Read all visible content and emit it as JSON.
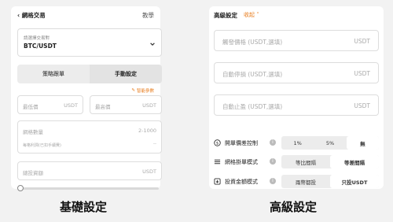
{
  "basic": {
    "header": {
      "back_label": "網格交易",
      "tutorial": "教學"
    },
    "pair": {
      "label": "請選擇交易對",
      "value": "BTC/USDT"
    },
    "tabs": [
      "策略跟單",
      "手動設定"
    ],
    "smart_param": "智能參數",
    "low_price": {
      "placeholder": "最低價",
      "unit": "USDT"
    },
    "high_price": {
      "placeholder": "最高價",
      "unit": "USDT"
    },
    "grid_count": {
      "placeholder": "網格數量",
      "range": "2-1000",
      "sub": "每格利潤(已扣手續費)",
      "sub_value": "--"
    },
    "investment": {
      "placeholder": "總投資額",
      "unit": "USDT"
    },
    "slider": {
      "value": 0
    },
    "caption": "基礎設定"
  },
  "advanced": {
    "title": "高級設定",
    "collapse": "收起",
    "trigger_price": {
      "placeholder": "觸發價格 (USDT,選填)",
      "unit": "USDT"
    },
    "stop_loss": {
      "placeholder": "自動停損 (USDT,選填)",
      "unit": "USDT"
    },
    "take_profit": {
      "placeholder": "自動止盈 (USDT,選填)",
      "unit": "USDT"
    },
    "rows": [
      {
        "label": "開單價差控制",
        "options": [
          "1%",
          "5%",
          "無"
        ],
        "active": 2
      },
      {
        "label": "網格掛單模式",
        "options": [
          "等比間隔",
          "等差間隔"
        ],
        "active": 1
      },
      {
        "label": "投資金額模式",
        "options": [
          "兩幣都投",
          "只投USDT"
        ],
        "active": 1
      }
    ],
    "caption": "高級設定"
  }
}
